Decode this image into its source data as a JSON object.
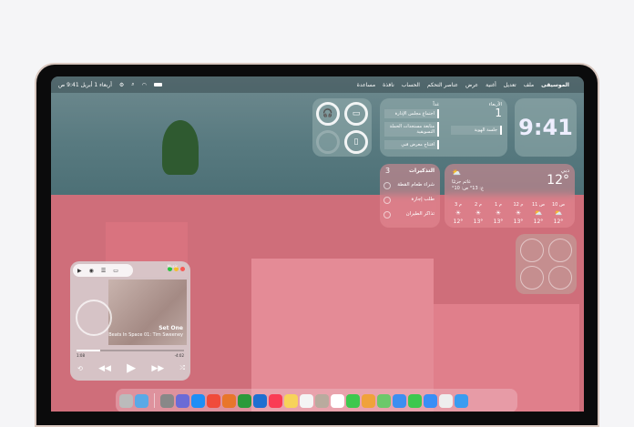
{
  "menubar": {
    "apple_icon": "apple-icon",
    "app": "الموسيقى",
    "items": [
      "ملف",
      "تعديل",
      "أغنية",
      "عرض",
      "عناصر التحكم",
      "الحساب",
      "نافذة",
      "مساعدة"
    ],
    "datetime": "أربعاء 1 أبريل 9:41 ص"
  },
  "calendar": {
    "today_label": "الأربعاء",
    "today_date": "1",
    "today_event": "جلسة الهوية",
    "tomorrow_label": "غداً",
    "tomorrow_events": [
      "اجتماع مجلس الإدارة",
      "متابعة مستجدات الحملة التسويقية",
      "افتتاح معرض فني"
    ]
  },
  "clock": {
    "time": "9:41"
  },
  "reminders": {
    "title": "التذكيرات",
    "count": "3",
    "items": [
      "شراء طعام القطة",
      "طلب إجازة",
      "تذاكر الطيران"
    ]
  },
  "weather": {
    "city": "دبي",
    "temp": "12°",
    "condition": "غائم جزئيًا",
    "hilo": "ع: 13° ص: 10°",
    "hours": [
      {
        "h": "3 م",
        "t": "12°"
      },
      {
        "h": "2 م",
        "t": "13°"
      },
      {
        "h": "1 م",
        "t": "13°"
      },
      {
        "h": "12 م",
        "t": "13°"
      },
      {
        "h": "11 ص",
        "t": "12°"
      },
      {
        "h": "10 ص",
        "t": "12°"
      }
    ]
  },
  "music": {
    "app": "Music",
    "title": "Set One",
    "subtitle": "Beats In Space 01: Tim Sweeney",
    "elapsed": "1:08",
    "remaining": "-4:02",
    "progress": 0.22
  },
  "batteries": [
    {
      "device": "headphones",
      "level": 0.7
    },
    {
      "device": "laptop",
      "level": 1.0
    },
    {
      "device": "none",
      "level": 0
    },
    {
      "device": "mouse",
      "level": 0.6
    }
  ],
  "dock": [
    "trash",
    "folder",
    "system-settings",
    "iphone-mirroring",
    "app-store",
    "launchpad",
    "pages",
    "numbers",
    "keynote",
    "music",
    "notes",
    "reminders",
    "contacts",
    "calendar",
    "phone",
    "photos",
    "maps",
    "mail",
    "messages",
    "safari",
    "launchpad-grid",
    "finder"
  ]
}
